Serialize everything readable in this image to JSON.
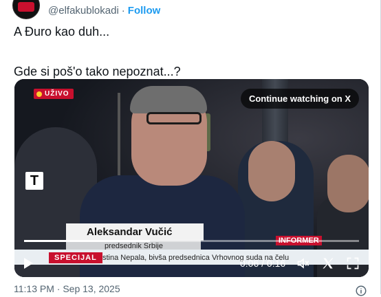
{
  "header": {
    "handle": "@elfakublokadi",
    "separator": "·",
    "follow_label": "Follow"
  },
  "tweet": {
    "line1": "A Đuro kao duh...",
    "line2": "Gde si poš'o tako nepoznat...?"
  },
  "video": {
    "live_label": "UŽIVO",
    "continue_label": "Continue watching on X",
    "channel_logo": "T",
    "lower_third_name": "Aleksandar Vučić",
    "lower_third_title": "predsednik Srbije",
    "special_label": "SPECIJAL",
    "ticker_text": "stina Nepala, bivša predsednica Vrhovnog suda na čelu",
    "network_label": "INFORMER",
    "time_display": "0:06 / 0:16",
    "progress": 0.375,
    "icons": [
      "play-icon",
      "volume-icon",
      "x-logo-icon",
      "fullscreen-icon"
    ]
  },
  "footer": {
    "timestamp": "11:13 PM · Sep 13, 2025",
    "info_icon": "info-icon"
  },
  "colors": {
    "accent": "#1d9bf0",
    "live_red": "#c8102e",
    "muted": "#536471"
  }
}
